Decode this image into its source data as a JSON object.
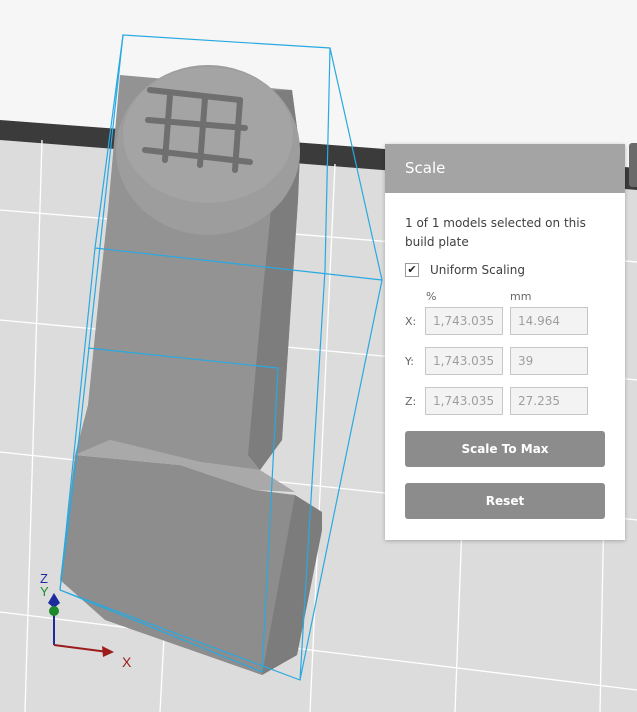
{
  "scale_panel": {
    "title": "Scale",
    "selection_info": "1 of 1 models selected on this build plate",
    "uniform_scaling": {
      "label": "Uniform Scaling",
      "checked": true,
      "check_glyph": "✔"
    },
    "columns": {
      "percent": "%",
      "mm": "mm"
    },
    "rows": [
      {
        "axis": "X:",
        "percent": "1,743.035",
        "mm": "14.964"
      },
      {
        "axis": "Y:",
        "percent": "1,743.035",
        "mm": "39"
      },
      {
        "axis": "Z:",
        "percent": "1,743.035",
        "mm": "27.235"
      }
    ],
    "scale_to_max_label": "Scale To Max",
    "reset_label": "Reset"
  },
  "axis_gizmo": {
    "x_label": "X",
    "y_label": "Y",
    "z_label": "Z"
  },
  "colors": {
    "background_top": "#f6f6f6",
    "build_plate": "#dcdcdc",
    "grid": "#ffffff",
    "plate_edge": "#3a3a3a",
    "model": "#8f8f8f",
    "bounding_box": "#29a9e1",
    "x_axis": "#9c1c1c",
    "y_axis": "#1c8a2a",
    "z_axis": "#1d2c9c"
  }
}
